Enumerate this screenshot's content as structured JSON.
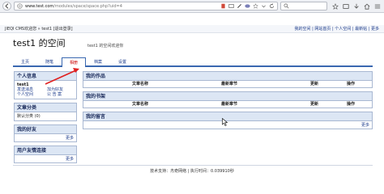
{
  "browser": {
    "url_host": "www.test.com",
    "url_path": "/modules/space/space.php?uid=4",
    "url_scheme": "http://"
  },
  "site_top": {
    "left_text": "JIEQI CMS欢迎您 » test1 [退出登录]",
    "right_links": "我的空间 | 网站首页 | 个人空间 | 最新帖 | 更多"
  },
  "space": {
    "title": "test1 的空间",
    "description": "test1 的空间欢迎你"
  },
  "tabs": [
    "主页",
    "随笔",
    "相册",
    "档案",
    "设置"
  ],
  "active_tab_index": 2,
  "sidebar": {
    "profile": {
      "heading": "个人信息",
      "username": "test1",
      "links": [
        "发送消息",
        "加为好友",
        "个人空间",
        "公 告 案"
      ]
    },
    "category": {
      "heading": "文章分类",
      "item": "默认分类 (0)"
    },
    "friends": {
      "heading": "我的好友",
      "more": "更多"
    },
    "links": {
      "heading": "用户友情连接",
      "more": "更多"
    }
  },
  "main": {
    "works": {
      "heading": "我的作品",
      "columns": [
        "文章名称",
        "最新章节",
        "更新",
        "操作"
      ]
    },
    "bookshelf": {
      "heading": "我的书架",
      "columns": [
        "文章名称",
        "最新章节",
        "更新",
        "操作"
      ]
    },
    "messages": {
      "heading": "我的留言",
      "more": "更多"
    }
  },
  "footer": {
    "text": "技术支持：杰奇网络 | 执行时间：0.039910秒"
  },
  "colors": {
    "accent": "#3a68b0",
    "header_bg": "#dce6f4",
    "arrow": "#e02020"
  }
}
